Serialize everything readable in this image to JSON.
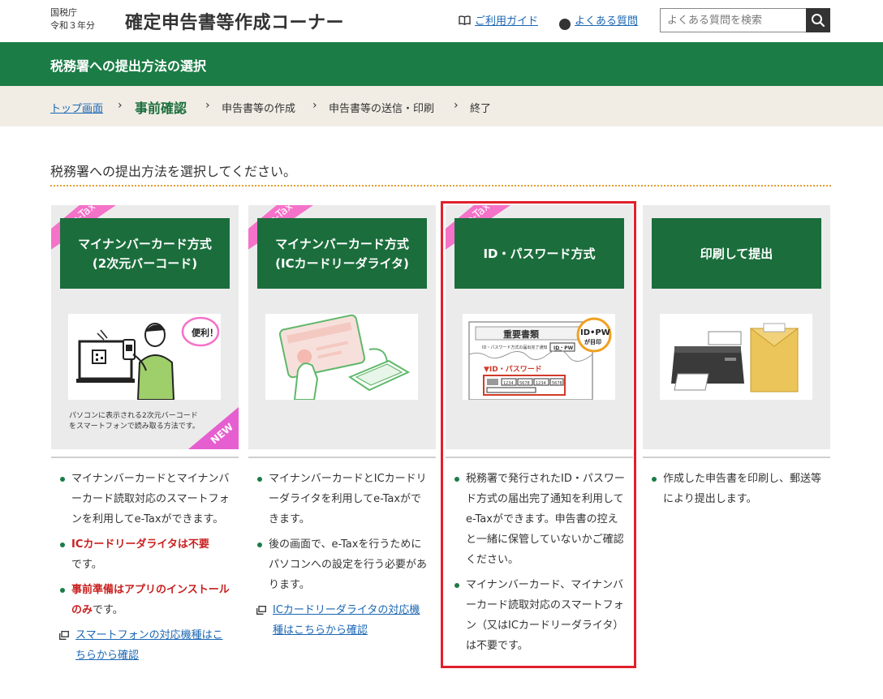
{
  "header": {
    "agency_line1": "国税庁",
    "agency_line2": "令和３年分",
    "site_title": "確定申告書等作成コーナー",
    "guide_link": "ご利用ガイド",
    "faq_link": "よくある質問",
    "search_placeholder": "よくある質問を検索"
  },
  "page_title": "税務署への提出方法の選択",
  "breadcrumb": {
    "top": "トップ画面",
    "current": "事前確認",
    "step3": "申告書等の作成",
    "step4": "申告書等の送信・印刷",
    "step5": "終了"
  },
  "instruction": "税務署への提出方法を選択してください。",
  "ribbons": {
    "etax": "e-Tax",
    "new": "NEW"
  },
  "cards": [
    {
      "title_line1": "マイナンバーカード方式",
      "title_line2": "(2次元バーコード)",
      "caption_line1": "パソコンに表示される2次元バーコード",
      "caption_line2": "をスマートフォンで読み取る方法です。",
      "bubble": "便利！",
      "desc1": "マイナンバーカードとマイナンバーカード読取対応のスマートフォンを利用してe-Taxができます。",
      "desc2_red": "ICカードリーダライタは不要",
      "desc2_rest": "です。",
      "desc3_red": "事前準備はアプリのインストールのみ",
      "desc3_rest": "です。",
      "link": "スマートフォンの対応機種はこちらから確認"
    },
    {
      "title_line1": "マイナンバーカード方式",
      "title_line2": "(ICカードリーダライタ)",
      "desc1": "マイナンバーカードとICカードリーダライタを利用してe-Taxができます。",
      "desc2": "後の画面で、e-Taxを行うためにパソコンへの設定を行う必要があります。",
      "link": "ICカードリーダライタの対応機種はこちらから確認"
    },
    {
      "title": "ID・パスワード方式",
      "img_doc_title": "重要書類",
      "img_doc_sub": "ID・パスワード方式の届出完了通知",
      "img_idpw": "ID・PW",
      "img_badge_line1": "ID•PW",
      "img_badge_line2": "が目印",
      "img_band": "▼ID・パスワード",
      "img_digits": [
        "1234",
        "5678",
        "1234",
        "5678"
      ],
      "desc1": "税務署で発行されたID・パスワード方式の届出完了通知を利用してe-Taxができます。申告書の控えと一緒に保管していないかご確認ください。",
      "desc2": "マイナンバーカード、マイナンバーカード読取対応のスマートフォン（又はICカードリーダライタ）は不要です。"
    },
    {
      "title": "印刷して提出",
      "desc1": "作成した申告書を印刷し、郵送等により提出します。"
    }
  ],
  "colors": {
    "green": "#1b7c45",
    "dark_green": "#1b6e3c",
    "link": "#1a66b3",
    "pink": "#f472c8",
    "red_text": "#c8201e",
    "highlight": "#e0202c"
  }
}
